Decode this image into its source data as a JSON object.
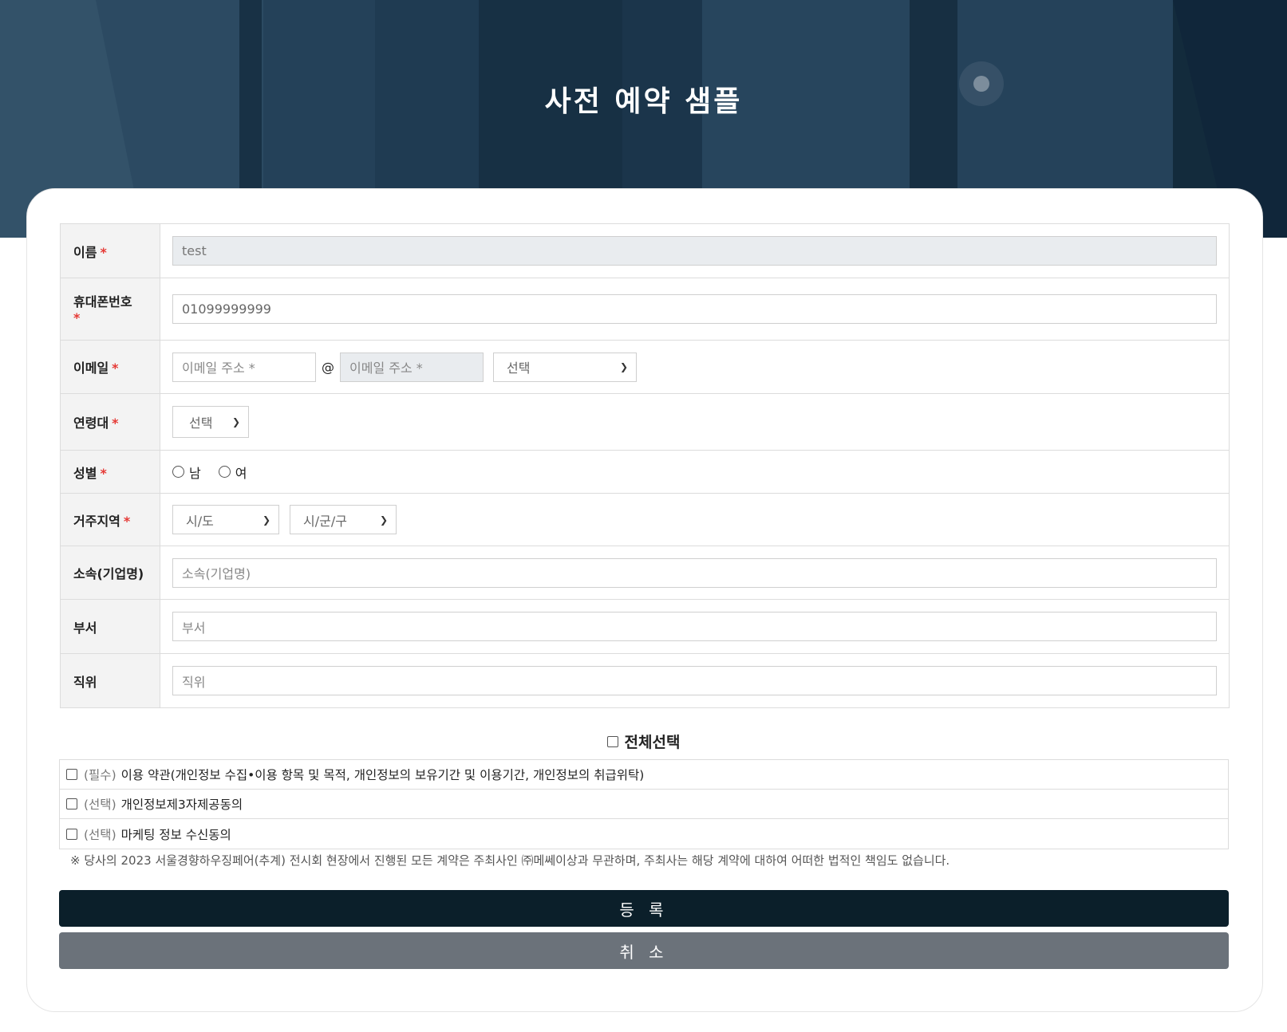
{
  "page": {
    "title": "사전 예약 샘플"
  },
  "form": {
    "name": {
      "label": "이름",
      "required": "*",
      "value": "test"
    },
    "phone": {
      "label": "휴대폰번호",
      "required": "*",
      "value": "01099999999"
    },
    "email": {
      "label": "이메일",
      "required": "*",
      "local_placeholder": "이메일 주소 *",
      "at": "@",
      "domain_placeholder": "이메일 주소 *",
      "domain_select": "선택"
    },
    "age": {
      "label": "연령대",
      "required": "*",
      "select": "선택"
    },
    "gender": {
      "label": "성별",
      "required": "*",
      "male": "남",
      "female": "여"
    },
    "region": {
      "label": "거주지역",
      "required": "*",
      "sido": "시/도",
      "sigungu": "시/군/구"
    },
    "company": {
      "label": "소속(기업명)",
      "placeholder": "소속(기업명)"
    },
    "dept": {
      "label": "부서",
      "placeholder": "부서"
    },
    "position": {
      "label": "직위",
      "placeholder": "직위"
    }
  },
  "consent": {
    "select_all": "전체선택",
    "items": [
      {
        "tag": "(필수)",
        "text": "이용 약관(개인정보 수집•이용 항목 및 목적, 개인정보의 보유기간 및 이용기간, 개인정보의 취급위탁)"
      },
      {
        "tag": "(선택)",
        "text": "개인정보제3자제공동의"
      },
      {
        "tag": "(선택)",
        "text": "마케팅 정보 수신동의"
      }
    ],
    "notice": "※ 당사의 2023 서울경향하우징페어(추계) 전시회 현장에서 진행된 모든 계약은 주최사인 ㈜메쎄이상과 무관하며, 주최사는 해당 계약에 대하여 어떠한 법적인 책임도 없습니다."
  },
  "buttons": {
    "submit": "등 록",
    "cancel": "취 소"
  },
  "colors": {
    "accent": "#0b1f2a",
    "cancel": "#6b727a",
    "required": "#e53935",
    "hero": "#2a4860"
  }
}
